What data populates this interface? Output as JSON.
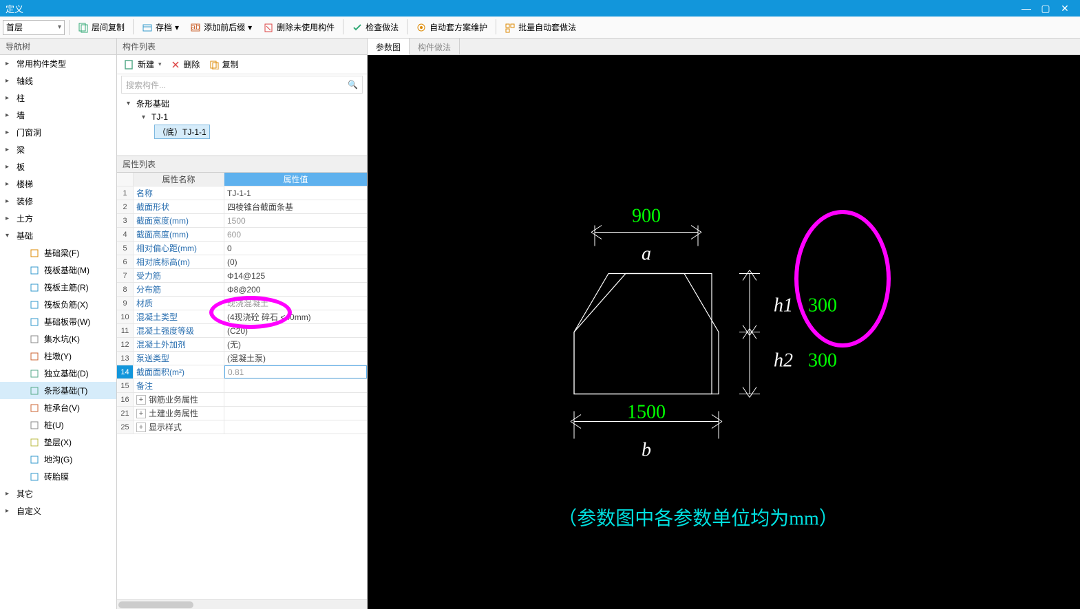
{
  "window": {
    "title": "定义"
  },
  "toolbar": {
    "floor": "首层",
    "btns": [
      {
        "label": "层间复制",
        "icon": "copy-layers"
      },
      {
        "label": "存档",
        "icon": "archive"
      },
      {
        "label": "添加前后缀",
        "icon": "affix"
      },
      {
        "label": "删除未使用构件",
        "icon": "delete-unused"
      },
      {
        "label": "检查做法",
        "icon": "check"
      },
      {
        "label": "自动套方案维护",
        "icon": "auto-scheme"
      },
      {
        "label": "批量自动套做法",
        "icon": "batch-auto"
      }
    ]
  },
  "nav": {
    "header": "导航树",
    "items": [
      {
        "label": "常用构件类型",
        "tw": "▸",
        "lvl": 1
      },
      {
        "label": "轴线",
        "tw": "▸",
        "lvl": 1
      },
      {
        "label": "柱",
        "tw": "▸",
        "lvl": 1
      },
      {
        "label": "墙",
        "tw": "▸",
        "lvl": 1
      },
      {
        "label": "门窗洞",
        "tw": "▸",
        "lvl": 1
      },
      {
        "label": "梁",
        "tw": "▸",
        "lvl": 1
      },
      {
        "label": "板",
        "tw": "▸",
        "lvl": 1
      },
      {
        "label": "楼梯",
        "tw": "▸",
        "lvl": 1
      },
      {
        "label": "装修",
        "tw": "▸",
        "lvl": 1
      },
      {
        "label": "土方",
        "tw": "▸",
        "lvl": 1
      },
      {
        "label": "基础",
        "tw": "▾",
        "lvl": 1,
        "expanded": true
      },
      {
        "label": "基础梁(F)",
        "lvl": 2,
        "ic": "pencil"
      },
      {
        "label": "筏板基础(M)",
        "lvl": 2,
        "ic": "grid"
      },
      {
        "label": "筏板主筋(R)",
        "lvl": 2,
        "ic": "grid"
      },
      {
        "label": "筏板负筋(X)",
        "lvl": 2,
        "ic": "grid"
      },
      {
        "label": "基础板带(W)",
        "lvl": 2,
        "ic": "lines"
      },
      {
        "label": "集水坑(K)",
        "lvl": 2,
        "ic": "pit"
      },
      {
        "label": "柱墩(Y)",
        "lvl": 2,
        "ic": "pier"
      },
      {
        "label": "独立基础(D)",
        "lvl": 2,
        "ic": "isol"
      },
      {
        "label": "条形基础(T)",
        "lvl": 2,
        "ic": "strip",
        "sel": true
      },
      {
        "label": "桩承台(V)",
        "lvl": 2,
        "ic": "cap"
      },
      {
        "label": "桩(U)",
        "lvl": 2,
        "ic": "pile"
      },
      {
        "label": "垫层(X)",
        "lvl": 2,
        "ic": "layer"
      },
      {
        "label": "地沟(G)",
        "lvl": 2,
        "ic": "trench"
      },
      {
        "label": "砖胎膜",
        "lvl": 2,
        "ic": "brick"
      },
      {
        "label": "其它",
        "tw": "▸",
        "lvl": 1
      },
      {
        "label": "自定义",
        "tw": "▸",
        "lvl": 1
      }
    ]
  },
  "complist": {
    "header": "构件列表",
    "btns": {
      "new": "新建",
      "del": "删除",
      "copy": "复制"
    },
    "search_placeholder": "搜索构件...",
    "tree": {
      "root": "条形基础",
      "child": "TJ-1",
      "leaf": "（底）TJ-1-1"
    }
  },
  "proplist": {
    "header": "属性列表",
    "col_name": "属性名称",
    "col_val": "属性值",
    "rows": [
      {
        "n": "1",
        "name": "名称",
        "val": "TJ-1-1",
        "link": true
      },
      {
        "n": "2",
        "name": "截面形状",
        "val": "四棱锥台截面条基",
        "link": true
      },
      {
        "n": "3",
        "name": "截面宽度(mm)",
        "val": "1500",
        "link": true,
        "gray": true
      },
      {
        "n": "4",
        "name": "截面高度(mm)",
        "val": "600",
        "link": true,
        "gray": true
      },
      {
        "n": "5",
        "name": "相对偏心距(mm)",
        "val": "0",
        "link": true
      },
      {
        "n": "6",
        "name": "相对底标高(m)",
        "val": "(0)",
        "link": true
      },
      {
        "n": "7",
        "name": "受力筋",
        "val": "Φ14@125",
        "link": true
      },
      {
        "n": "8",
        "name": "分布筋",
        "val": "Φ8@200",
        "link": true
      },
      {
        "n": "9",
        "name": "材质",
        "val": "现浇混凝土",
        "link": true,
        "gray": true
      },
      {
        "n": "10",
        "name": "混凝土类型",
        "val": "(4现浇砼 碎石 <40mm)",
        "link": true
      },
      {
        "n": "11",
        "name": "混凝土强度等级",
        "val": "(C20)",
        "link": true
      },
      {
        "n": "12",
        "name": "混凝土外加剂",
        "val": "(无)",
        "link": true
      },
      {
        "n": "13",
        "name": "泵送类型",
        "val": "(混凝土泵)",
        "link": true
      },
      {
        "n": "14",
        "name": "截面面积(m²)",
        "val": "0.81",
        "link": true,
        "sel": true,
        "gray": true
      },
      {
        "n": "15",
        "name": "备注",
        "val": "",
        "link": true
      },
      {
        "n": "16",
        "name": "钢筋业务属性",
        "val": "",
        "exp": true
      },
      {
        "n": "21",
        "name": "土建业务属性",
        "val": "",
        "exp": true
      },
      {
        "n": "25",
        "name": "显示样式",
        "val": "",
        "exp": true
      }
    ]
  },
  "tabs": {
    "active": "参数图",
    "other": "构件做法"
  },
  "diagram": {
    "a_val": "900",
    "a_lbl": "a",
    "b_val": "1500",
    "b_lbl": "b",
    "h1_lbl": "h1",
    "h1_val": "300",
    "h2_lbl": "h2",
    "h2_val": "300",
    "note": "（参数图中各参数单位均为mm）"
  }
}
